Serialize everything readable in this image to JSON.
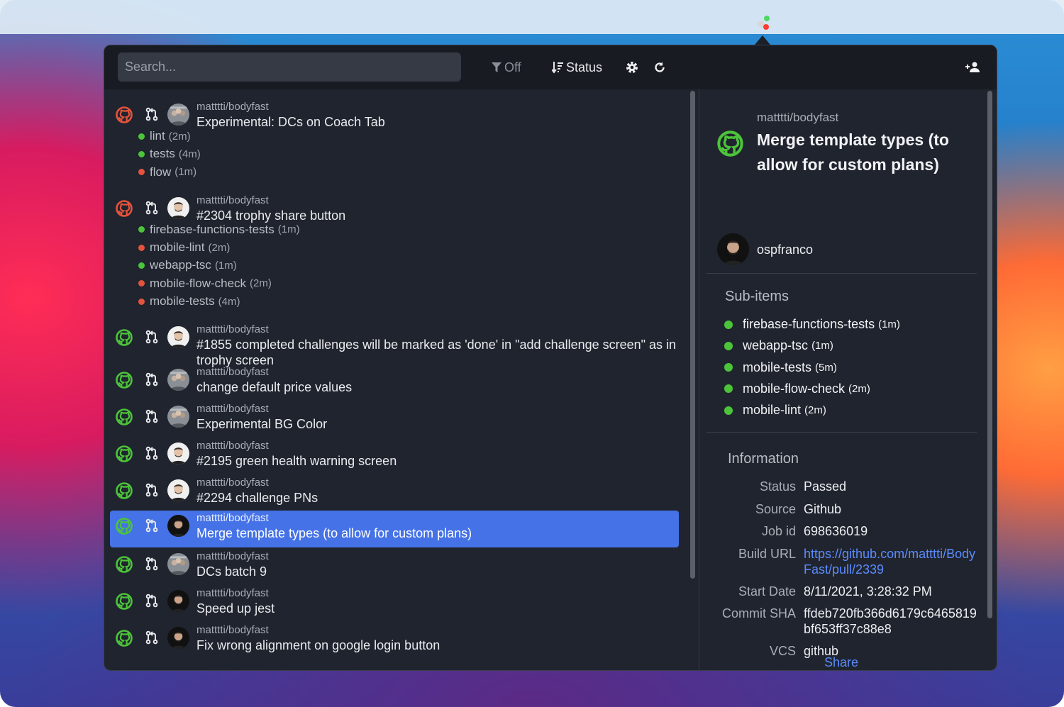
{
  "toolbar": {
    "search_placeholder": "Search...",
    "filter_label": "Off",
    "sort_label": "Status"
  },
  "colors": {
    "success": "#4cc43a",
    "failure": "#e5533c",
    "selected": "#4572e6",
    "link": "#5b8cff"
  },
  "list": [
    {
      "repo": "matttti/bodyfast",
      "title": "Experimental: DCs on Coach Tab",
      "status": "failure",
      "avatar": "group",
      "subs": [
        {
          "name": "lint",
          "dur": "(2m)",
          "status": "success"
        },
        {
          "name": "tests",
          "dur": "(4m)",
          "status": "success"
        },
        {
          "name": "flow",
          "dur": "(1m)",
          "status": "failure"
        }
      ]
    },
    {
      "repo": "matttti/bodyfast",
      "title": "#2304 trophy share button",
      "status": "failure",
      "avatar": "man-light",
      "subs": [
        {
          "name": "firebase-functions-tests",
          "dur": "(1m)",
          "status": "success"
        },
        {
          "name": "mobile-lint",
          "dur": "(2m)",
          "status": "failure"
        },
        {
          "name": "webapp-tsc",
          "dur": "(1m)",
          "status": "success"
        },
        {
          "name": "mobile-flow-check",
          "dur": "(2m)",
          "status": "failure"
        },
        {
          "name": "mobile-tests",
          "dur": "(4m)",
          "status": "failure"
        }
      ]
    },
    {
      "repo": "matttti/bodyfast",
      "title": "#1855 completed challenges will be marked as 'done' in \"add challenge screen\" as in",
      "title2": "trophy screen",
      "status": "success",
      "avatar": "man-light"
    },
    {
      "repo": "matttti/bodyfast",
      "title": "change default price values",
      "status": "success",
      "avatar": "group"
    },
    {
      "repo": "matttti/bodyfast",
      "title": "Experimental BG Color",
      "status": "success",
      "avatar": "group"
    },
    {
      "repo": "matttti/bodyfast",
      "title": "#2195 green health warning screen",
      "status": "success",
      "avatar": "man-light"
    },
    {
      "repo": "matttti/bodyfast",
      "title": "#2294 challenge PNs",
      "status": "success",
      "avatar": "man-light"
    },
    {
      "repo": "matttti/bodyfast",
      "title": "Merge template types (to allow for custom plans)",
      "status": "success",
      "avatar": "man-dark",
      "selected": true
    },
    {
      "repo": "matttti/bodyfast",
      "title": "DCs batch 9",
      "status": "success",
      "avatar": "group"
    },
    {
      "repo": "matttti/bodyfast",
      "title": "Speed up jest",
      "status": "success",
      "avatar": "man-dark"
    },
    {
      "repo": "matttti/bodyfast",
      "title": "Fix wrong alignment on google login button",
      "status": "success",
      "avatar": "man-dark"
    }
  ],
  "detail": {
    "repo": "matttti/bodyfast",
    "title": "Merge template types (to allow for custom plans)",
    "author": "ospfranco",
    "subitems_heading": "Sub-items",
    "subitems": [
      {
        "name": "firebase-functions-tests",
        "dur": "(1m)"
      },
      {
        "name": "webapp-tsc",
        "dur": "(1m)"
      },
      {
        "name": "mobile-tests",
        "dur": "(5m)"
      },
      {
        "name": "mobile-flow-check",
        "dur": "(2m)"
      },
      {
        "name": "mobile-lint",
        "dur": "(2m)"
      }
    ],
    "info_heading": "Information",
    "info": [
      {
        "k": "Status",
        "v": "Passed"
      },
      {
        "k": "Source",
        "v": "Github"
      },
      {
        "k": "Job id",
        "v": "698636019"
      },
      {
        "k": "Build URL",
        "v": "https://github.com/matttti/BodyFast/pull/2339",
        "link": true
      },
      {
        "k": "Start Date",
        "v": "8/11/2021, 3:28:32 PM"
      },
      {
        "k": "Commit SHA",
        "v": "ffdeb720fb366d6179c6465819bf653ff37c88e8"
      },
      {
        "k": "VCS",
        "v": "github"
      }
    ],
    "share_label": "Share"
  }
}
